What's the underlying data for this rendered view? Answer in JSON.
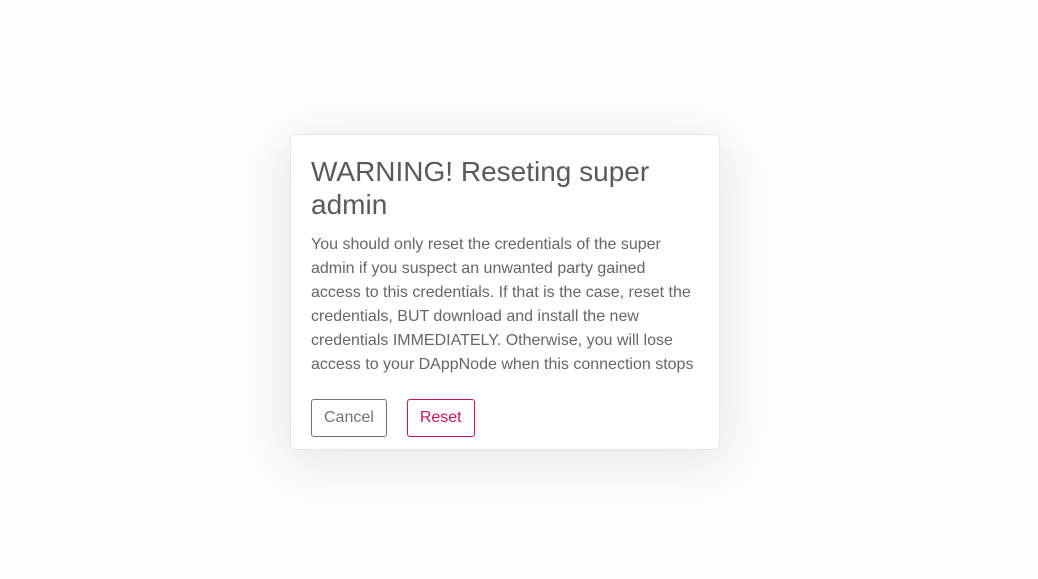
{
  "modal": {
    "title": "WARNING! Reseting super admin",
    "message": "You should only reset the credentials of the super admin if you suspect an unwanted party gained access to this credentials. If that is the case, reset the credentials, BUT download and install the new credentials IMMEDIATELY. Otherwise, you will lose access to your DAppNode when this connection stops",
    "cancel_label": "Cancel",
    "reset_label": "Reset"
  },
  "colors": {
    "danger": "#d1125a",
    "secondary": "#6c757d",
    "title": "#5a5a5a",
    "text": "#666666"
  }
}
